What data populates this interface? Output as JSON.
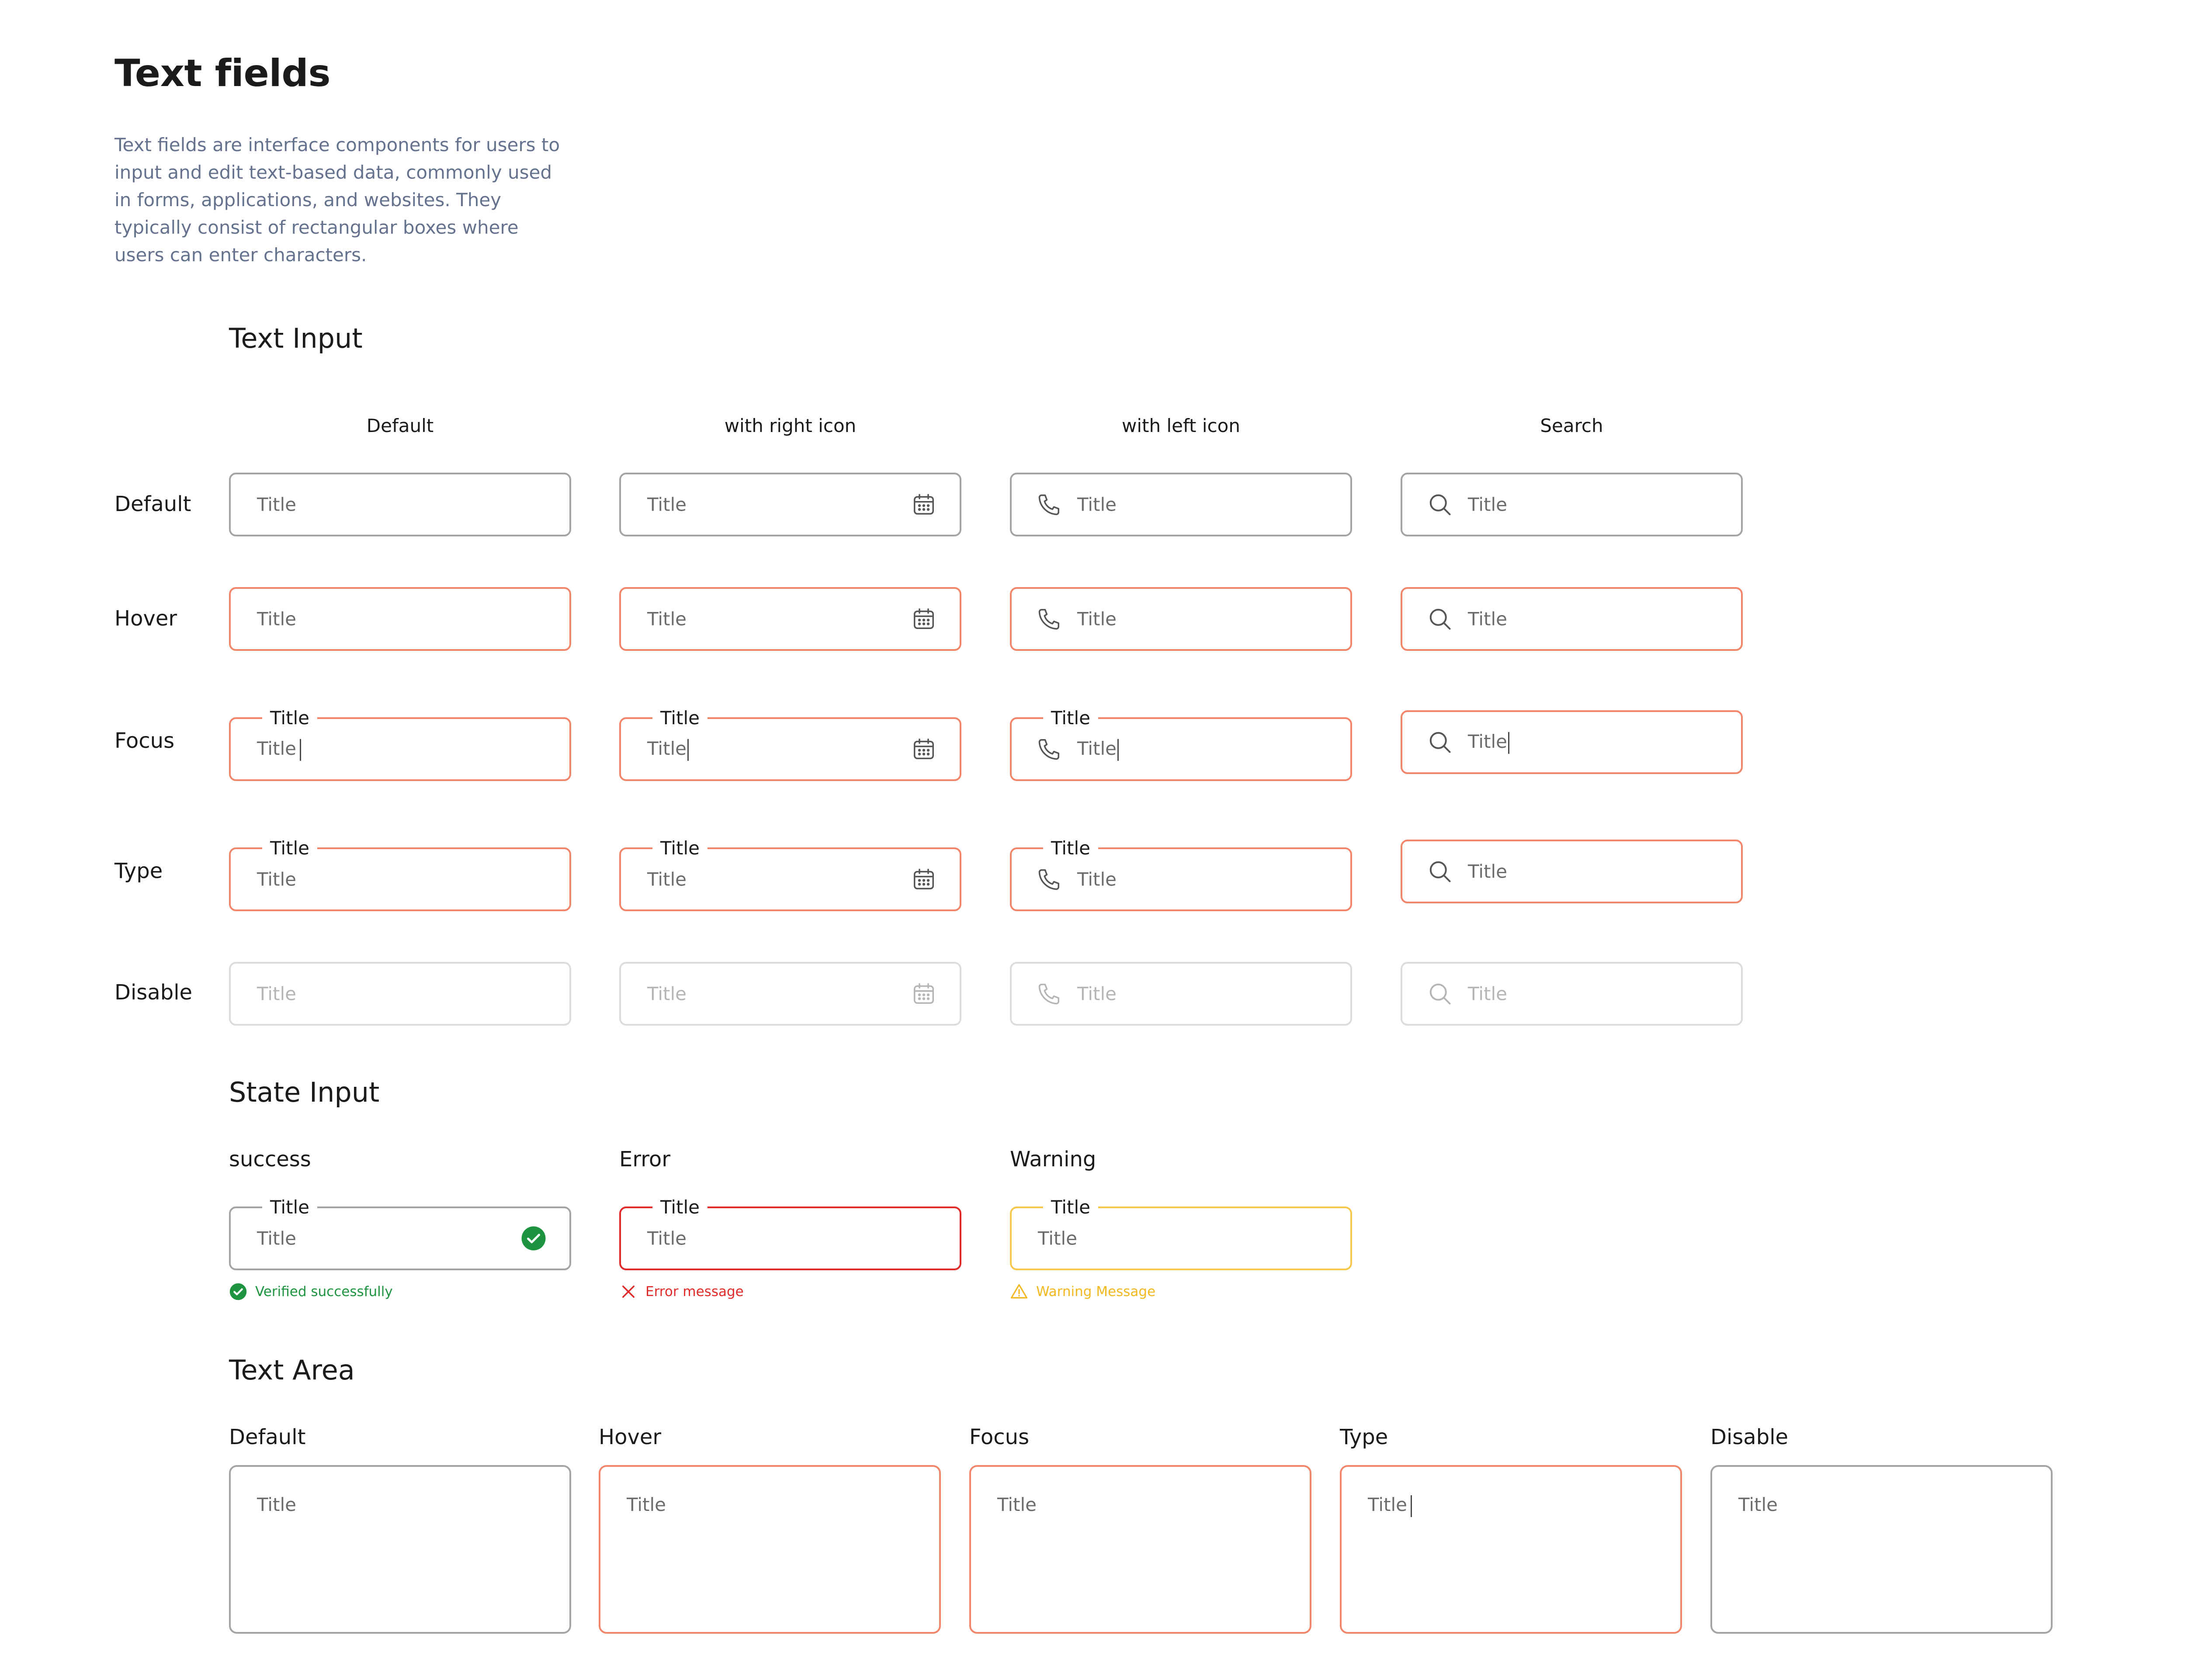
{
  "page": {
    "title": "Text fields",
    "description": "Text fields are interface components for users to input and edit text-based data, commonly used in forms, applications, and websites. They typically consist of rectangular boxes where users can enter characters."
  },
  "text_input": {
    "heading": "Text Input",
    "columns": [
      "Default",
      "with right icon",
      "with  left icon",
      "Search"
    ],
    "rows": [
      "Default",
      "Hover",
      "Focus",
      "Type",
      "Disable"
    ],
    "field_label": "Title",
    "placeholder": "Title"
  },
  "state_input": {
    "heading": "State Input",
    "success": {
      "label": "success",
      "field_label": "Title",
      "value": "Title",
      "message": "Verified successfully",
      "color": "#1e9440"
    },
    "error": {
      "label": "Error",
      "field_label": "Title",
      "value": "Title",
      "message": "Error message",
      "color": "#e12b2b"
    },
    "warning": {
      "label": "Warning",
      "field_label": "Title",
      "value": "Title",
      "message": "Warning Message",
      "color": "#f2b820"
    }
  },
  "text_area": {
    "heading": "Text Area",
    "states": [
      "Default",
      "Hover",
      "Focus",
      "Type",
      "Disable"
    ],
    "placeholder": "Title"
  },
  "colors": {
    "default_border": "#a4a4a4",
    "accent_border": "#f2866a",
    "disabled_border": "#dcdcdc",
    "text": "#1b1b1b",
    "description_text": "#65728d"
  },
  "icons": {
    "right_icon": "calendar-icon",
    "left_icon": "phone-icon",
    "search_icon": "search-icon"
  }
}
